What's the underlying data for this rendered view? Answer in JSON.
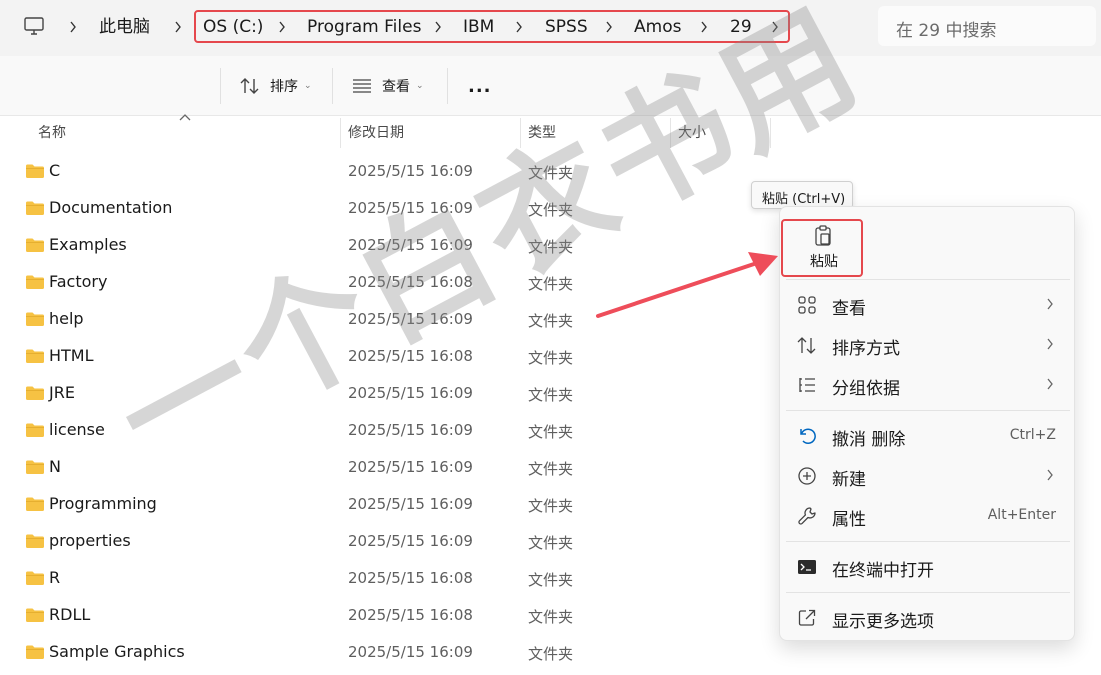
{
  "address": {
    "this_pc": "此电脑",
    "path": [
      "OS (C:)",
      "Program Files",
      "IBM",
      "SPSS",
      "Amos",
      "29"
    ],
    "search_placeholder": "在 29 中搜索"
  },
  "toolbar": {
    "sort_label": "排序",
    "view_label": "查看",
    "more_label": "..."
  },
  "columns": {
    "name": "名称",
    "modified": "修改日期",
    "type": "类型",
    "size": "大小"
  },
  "files": [
    {
      "name": "C",
      "date": "2025/5/15 16:09",
      "type": "文件夹"
    },
    {
      "name": "Documentation",
      "date": "2025/5/15 16:09",
      "type": "文件夹"
    },
    {
      "name": "Examples",
      "date": "2025/5/15 16:09",
      "type": "文件夹"
    },
    {
      "name": "Factory",
      "date": "2025/5/15 16:08",
      "type": "文件夹"
    },
    {
      "name": "help",
      "date": "2025/5/15 16:09",
      "type": "文件夹"
    },
    {
      "name": "HTML",
      "date": "2025/5/15 16:08",
      "type": "文件夹"
    },
    {
      "name": "JRE",
      "date": "2025/5/15 16:09",
      "type": "文件夹"
    },
    {
      "name": "license",
      "date": "2025/5/15 16:09",
      "type": "文件夹"
    },
    {
      "name": "N",
      "date": "2025/5/15 16:09",
      "type": "文件夹"
    },
    {
      "name": "Programming",
      "date": "2025/5/15 16:09",
      "type": "文件夹"
    },
    {
      "name": "properties",
      "date": "2025/5/15 16:09",
      "type": "文件夹"
    },
    {
      "name": "R",
      "date": "2025/5/15 16:08",
      "type": "文件夹"
    },
    {
      "name": "RDLL",
      "date": "2025/5/15 16:08",
      "type": "文件夹"
    },
    {
      "name": "Sample Graphics",
      "date": "2025/5/15 16:09",
      "type": "文件夹"
    }
  ],
  "tooltip": "粘贴 (Ctrl+V)",
  "menu": {
    "paste_label": "粘贴",
    "items": [
      {
        "label": "查看",
        "shortcut": ""
      },
      {
        "label": "排序方式",
        "shortcut": ""
      },
      {
        "label": "分组依据",
        "shortcut": ""
      },
      {
        "label": "撤消 删除",
        "shortcut": "Ctrl+Z"
      },
      {
        "label": "新建",
        "shortcut": ""
      },
      {
        "label": "属性",
        "shortcut": "Alt+Enter"
      },
      {
        "label": "在终端中打开",
        "shortcut": ""
      },
      {
        "label": "显示更多选项",
        "shortcut": ""
      }
    ]
  },
  "watermark": "一个白衣书用",
  "colors": {
    "highlight_border": "#e5484d",
    "arrow": "#ee4d5a",
    "folder": "#f6c243",
    "accent": "#0067c0"
  }
}
